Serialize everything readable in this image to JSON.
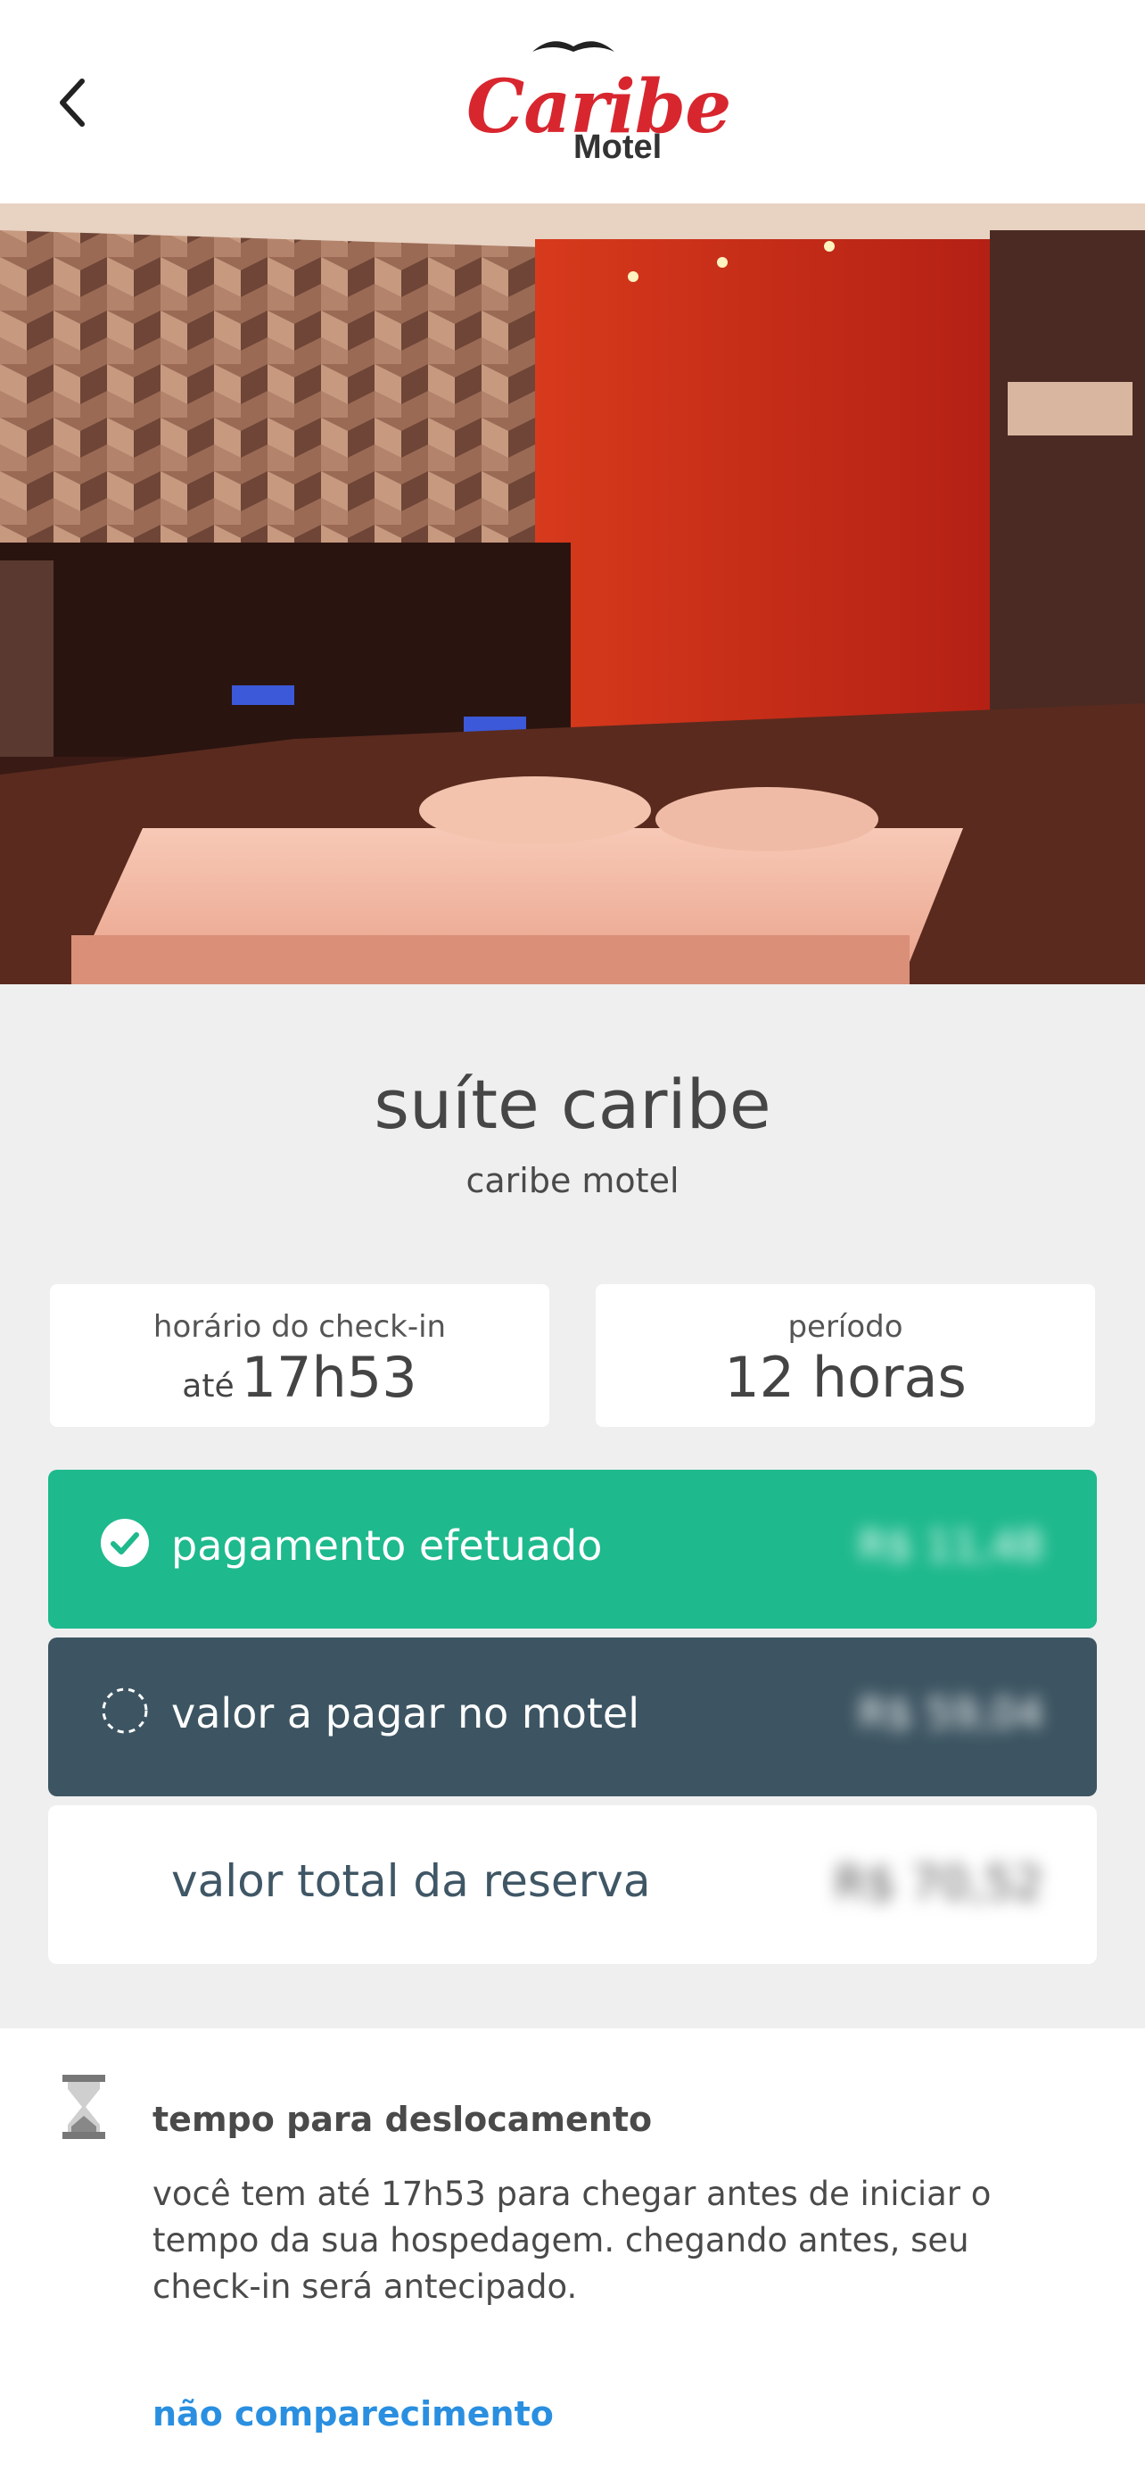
{
  "header": {
    "back_icon": "chevron-left-icon",
    "logo": {
      "brand": "Caribe",
      "sub": "Motel"
    }
  },
  "hero": {
    "alt": "suite room photo"
  },
  "suite": {
    "title": "suíte caribe",
    "motel": "caribe motel"
  },
  "checkin_card": {
    "label": "horário do check-in",
    "prefix": "até",
    "value": "17h53"
  },
  "period_card": {
    "label": "período",
    "value": "12 horas"
  },
  "payments": {
    "paid": {
      "label": "pagamento efetuado",
      "value": "R$ 11,48",
      "icon": "check-circle-icon",
      "color": "#1eb98d"
    },
    "due": {
      "label": "valor a pagar no motel",
      "value": "R$ 59,04",
      "icon": "dashed-circle-icon",
      "color": "#3d5562"
    },
    "total": {
      "label": "valor total da reserva",
      "value": "R$ 70,52"
    }
  },
  "travel": {
    "icon": "hourglass-icon",
    "title": "tempo para deslocamento",
    "text": "você tem até 17h53 para chegar antes de iniciar o tempo da sua hospedagem. chegando antes, seu check-in será antecipado."
  },
  "no_show_link": "não comparecimento"
}
